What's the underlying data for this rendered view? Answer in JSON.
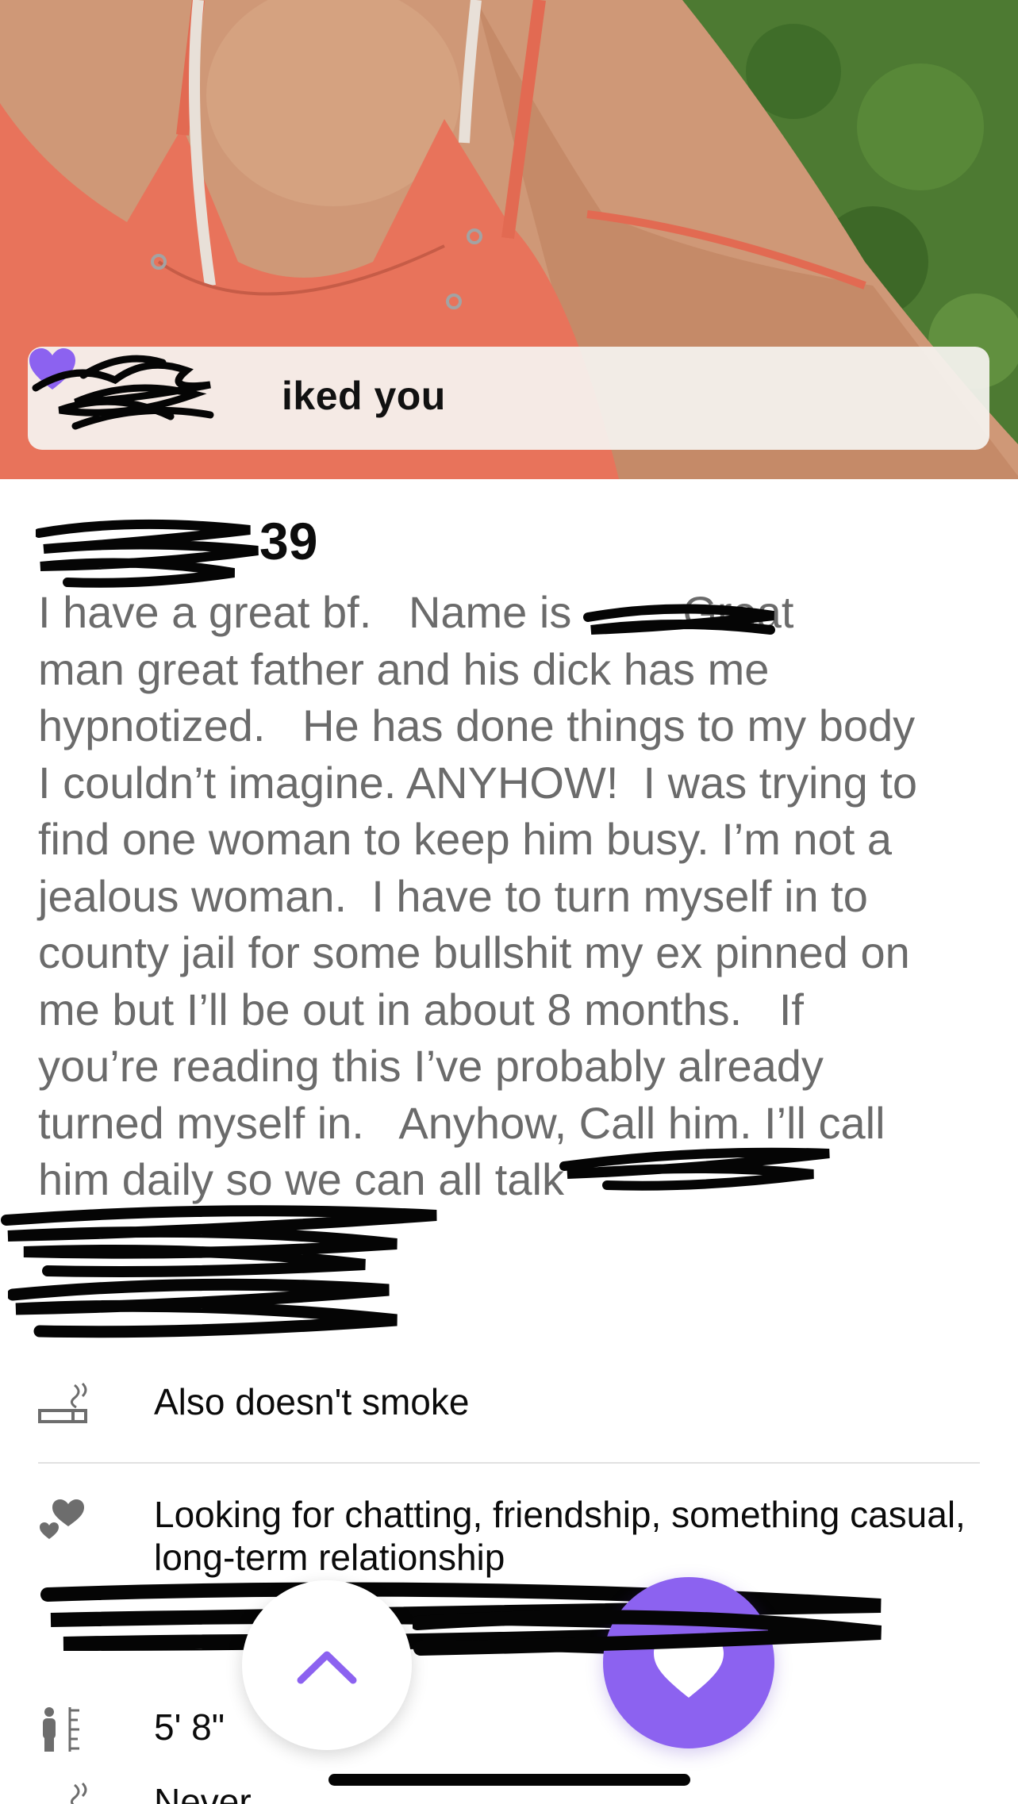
{
  "banner": {
    "liked_text": "iked you"
  },
  "profile": {
    "age": "39",
    "bio": "I have a great bf.   Name is         Great\nman great father and his dick has me\nhypnotized.   He has done things to my body\nI couldn’t imagine. ANYHOW!  I was trying to\nfind one woman to keep him busy. I’m not a\njealous woman.  I have to turn myself in to\ncounty jail for some bullshit my ex pinned on\nme but I’ll be out in about 8 months.   If\nyou’re reading this I’ve probably already\nturned myself in.   Anyhow, Call him. I’ll call\nhim daily so we can all talk",
    "smoking": "Also doesn't smoke",
    "looking_for_line1": "Looking for chatting, friendship, something casual,",
    "looking_for_line2": "long-term relationship",
    "height": "5' 8\"",
    "partial_next": "Never"
  },
  "colors": {
    "accent": "#8c62f0",
    "bio_text": "#6b6b6b",
    "banner_bg": "#f5f3f0"
  },
  "icons": {
    "banner": "heart-icon",
    "smoking": "no-smoking-icon",
    "looking_for": "hearts-icon",
    "height": "height-ruler-icon",
    "dismiss": "chevron-up-icon",
    "like": "heart-icon"
  }
}
